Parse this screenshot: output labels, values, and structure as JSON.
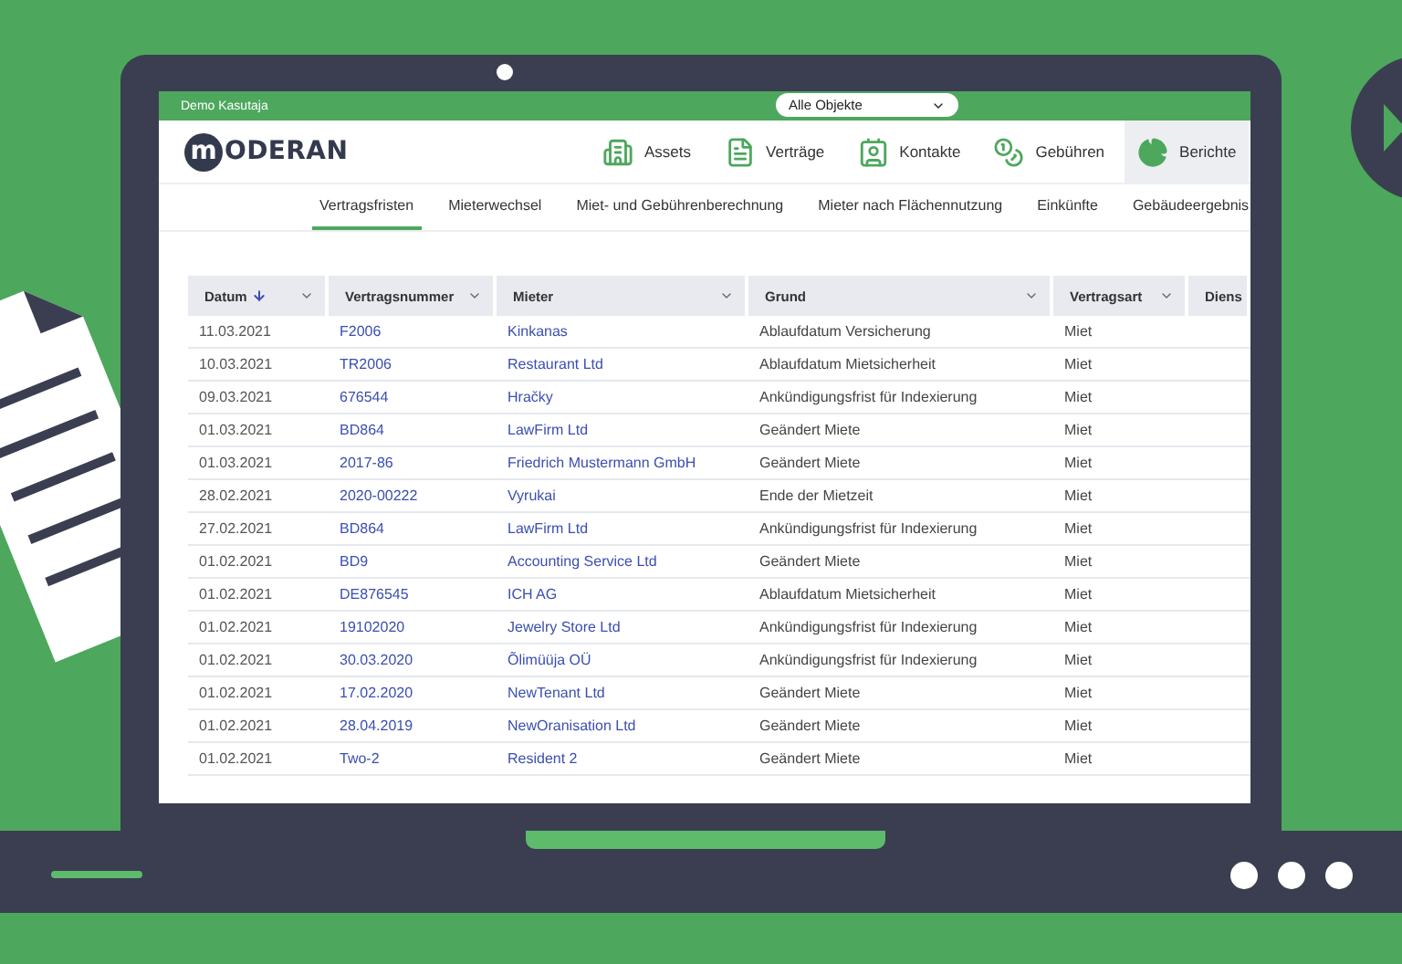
{
  "top_bar": {
    "user": "Demo Kasutaja",
    "object_select": "Alle Objekte"
  },
  "logo": {
    "mark": "m",
    "text": "ODERAN"
  },
  "nav": [
    {
      "kind": "building",
      "label": "Assets",
      "selected": false
    },
    {
      "kind": "document",
      "label": "Verträge",
      "selected": false
    },
    {
      "kind": "contact",
      "label": "Kontakte",
      "selected": false
    },
    {
      "kind": "coins",
      "label": "Gebühren",
      "selected": false
    },
    {
      "kind": "pie",
      "label": "Berichte",
      "selected": true
    }
  ],
  "subtabs": [
    {
      "label": "Vertragsfristen",
      "selected": true
    },
    {
      "label": "Mieterwechsel",
      "selected": false
    },
    {
      "label": "Miet- und Gebührenberechnung",
      "selected": false
    },
    {
      "label": "Mieter nach Flächennutzung",
      "selected": false
    },
    {
      "label": "Einkünfte",
      "selected": false
    },
    {
      "label": "Gebäudeergebnis",
      "selected": false
    }
  ],
  "table": {
    "columns": [
      {
        "label": "Datum",
        "sorted": true,
        "filter": true
      },
      {
        "label": "Vertragsnummer",
        "sorted": false,
        "filter": true
      },
      {
        "label": "Mieter",
        "sorted": false,
        "filter": true
      },
      {
        "label": "Grund",
        "sorted": false,
        "filter": true
      },
      {
        "label": "Vertragsart",
        "sorted": false,
        "filter": true
      },
      {
        "label": "Diens",
        "sorted": false
      }
    ],
    "rows": [
      [
        "11.03.2021",
        "F2006",
        "Kinkanas",
        "Ablaufdatum Versicherung",
        "Miet"
      ],
      [
        "10.03.2021",
        "TR2006",
        "Restaurant Ltd",
        "Ablaufdatum Mietsicherheit",
        "Miet"
      ],
      [
        "09.03.2021",
        "676544",
        "Hračky",
        "Ankündigungsfrist für Indexierung",
        "Miet"
      ],
      [
        "01.03.2021",
        "BD864",
        "LawFirm Ltd",
        "Geändert Miete",
        "Miet"
      ],
      [
        "01.03.2021",
        "2017-86",
        "Friedrich Mustermann GmbH",
        "Geändert Miete",
        "Miet"
      ],
      [
        "28.02.2021",
        "2020-00222",
        "Vyrukai",
        "Ende der Mietzeit",
        "Miet"
      ],
      [
        "27.02.2021",
        "BD864",
        "LawFirm Ltd",
        "Ankündigungsfrist für Indexierung",
        "Miet"
      ],
      [
        "01.02.2021",
        "BD9",
        "Accounting Service Ltd",
        "Geändert Miete",
        "Miet"
      ],
      [
        "01.02.2021",
        "DE876545",
        "ICH AG",
        "Ablaufdatum Mietsicherheit",
        "Miet"
      ],
      [
        "01.02.2021",
        "19102020",
        "Jewelry Store Ltd",
        "Ankündigungsfrist für Indexierung",
        "Miet"
      ],
      [
        "01.02.2021",
        "30.03.2020",
        "Õlimüüja OÜ",
        "Ankündigungsfrist für Indexierung",
        "Miet"
      ],
      [
        "01.02.2021",
        "17.02.2020",
        "NewTenant Ltd",
        "Geändert Miete",
        "Miet"
      ],
      [
        "01.02.2021",
        "28.04.2019",
        "NewOranisation Ltd",
        "Geändert Miete",
        "Miet"
      ],
      [
        "01.02.2021",
        "Two-2",
        "Resident 2",
        "Geändert Miete",
        "Miet"
      ]
    ]
  }
}
